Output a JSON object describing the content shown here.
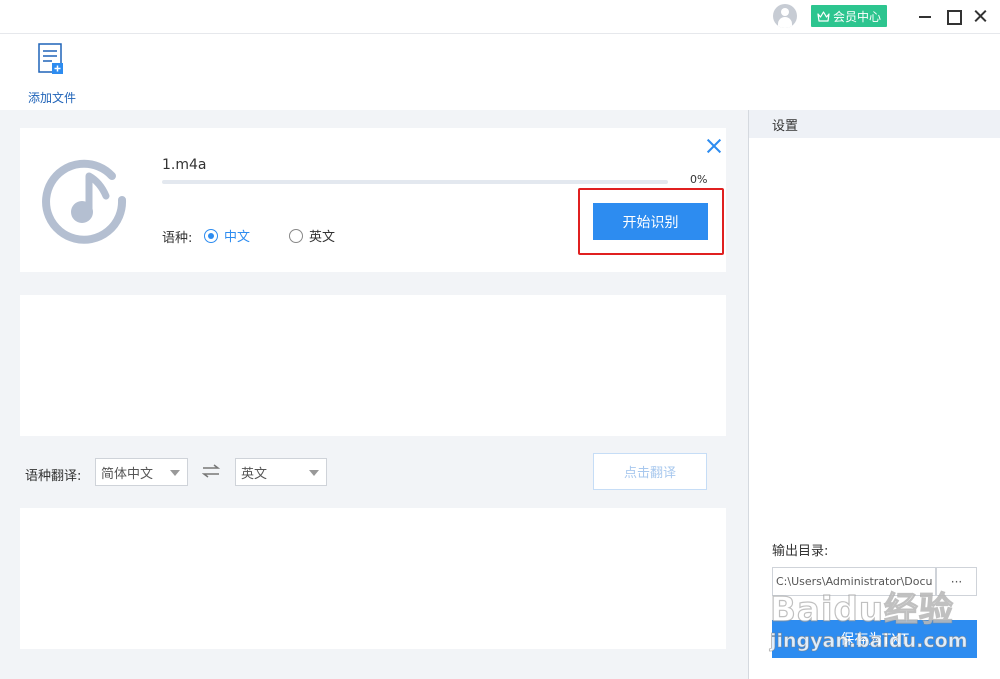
{
  "titlebar": {
    "member_center_label": "会员中心"
  },
  "toolbar": {
    "add_file_label": "添加文件"
  },
  "file_card": {
    "file_name": "1.m4a",
    "progress": 0,
    "progress_text": "0%",
    "language_label": "语种:",
    "language_options": [
      "中文",
      "英文"
    ],
    "selected_language": "中文",
    "start_button_label": "开始识别"
  },
  "translate": {
    "label": "语种翻译:",
    "source_language": "简体中文",
    "target_language": "英文",
    "translate_button_label": "点击翻译"
  },
  "sidebar": {
    "settings_label": "设置",
    "output_dir_label": "输出目录:",
    "output_path": "C:\\Users\\Administrator\\Documents",
    "browse_label": "···",
    "save_button_label": "保存为TXT"
  },
  "watermark": {
    "logo_text": "Baidu经验",
    "url_text": "jingyan.baidu.com"
  },
  "colors": {
    "accent": "#2d8cf0",
    "member_green": "#2dc58f",
    "highlight_red": "#e02020",
    "panel_bg": "#f2f4f7"
  }
}
